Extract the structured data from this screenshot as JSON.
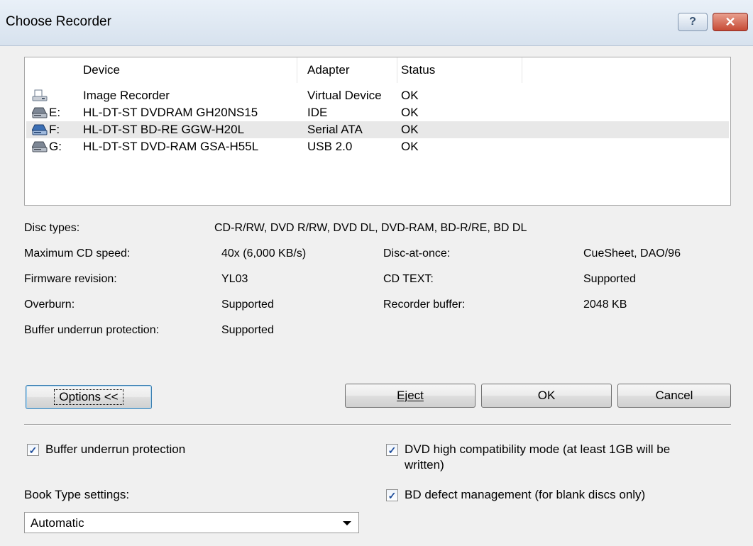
{
  "window": {
    "title": "Choose Recorder",
    "help_glyph": "?",
    "close_glyph": "✕"
  },
  "device_list": {
    "columns": [
      "Device",
      "Adapter",
      "Status"
    ],
    "rows": [
      {
        "letter": "",
        "device": "Image Recorder",
        "adapter": "Virtual Device",
        "status": "OK",
        "icon": "image-recorder-icon"
      },
      {
        "letter": "E:",
        "device": "HL-DT-ST DVDRAM GH20NS15",
        "adapter": "IDE",
        "status": "OK",
        "icon": "optical-drive-icon"
      },
      {
        "letter": "F:",
        "device": "HL-DT-ST BD-RE  GGW-H20L",
        "adapter": "Serial ATA",
        "status": "OK",
        "icon": "optical-drive-icon",
        "selected": true
      },
      {
        "letter": "G:",
        "device": "HL-DT-ST DVD-RAM GSA-H55L",
        "adapter": "USB 2.0",
        "status": "OK",
        "icon": "optical-drive-icon"
      }
    ]
  },
  "info": {
    "disc_types_label": "Disc types:",
    "disc_types_value": "CD-R/RW, DVD R/RW, DVD DL, DVD-RAM, BD-R/RE, BD DL",
    "max_cd_speed_label": "Maximum CD speed:",
    "max_cd_speed_value": "40x (6,000 KB/s)",
    "firmware_label": "Firmware revision:",
    "firmware_value": "YL03",
    "overburn_label": "Overburn:",
    "overburn_value": "Supported",
    "buffer_label": "Buffer underrun protection:",
    "buffer_value": "Supported",
    "dao_label": "Disc-at-once:",
    "dao_value": "CueSheet, DAO/96",
    "cdtext_label": "CD TEXT:",
    "cdtext_value": "Supported",
    "recorder_buffer_label": "Recorder buffer:",
    "recorder_buffer_value": "2048 KB"
  },
  "buttons": {
    "options": "Options <<",
    "eject": "Eject",
    "ok": "OK",
    "cancel": "Cancel"
  },
  "options": {
    "buffer_underrun": {
      "label": "Buffer underrun protection",
      "checked": true
    },
    "dvd_compat": {
      "label_line1": "DVD high compatibility mode (at least 1GB will be",
      "label_line2": "written)",
      "checked": true
    },
    "bd_defect": {
      "label": "BD defect management (for blank discs only)",
      "checked": true
    },
    "book_type_label": "Book Type settings:",
    "book_type_value": "Automatic"
  },
  "colors": {
    "selected_row": "#e8e8e8",
    "check_mark": "#1d4c9a"
  }
}
